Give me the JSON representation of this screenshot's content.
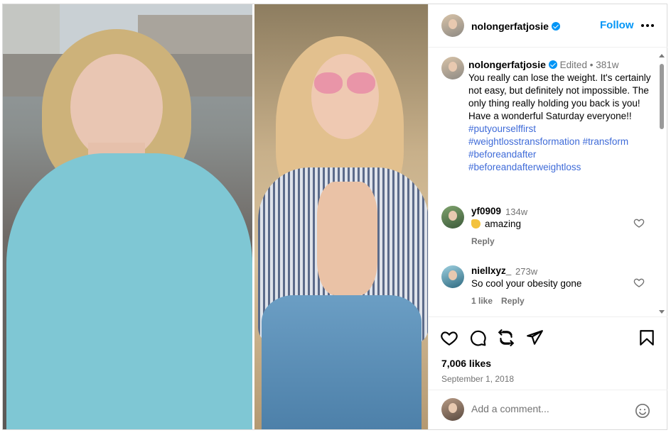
{
  "post": {
    "username": "nolongerfatjosie",
    "follow_label": "Follow",
    "more_icon": "more-horizontal-icon"
  },
  "caption": {
    "username": "nolongerfatjosie",
    "edited": "Edited",
    "separator": "•",
    "time": "381w",
    "text": "You really can lose the weight. It's certainly not easy, but definitely not impossible. The only thing really holding you back is you! Have a wonderful Saturday everyone!!",
    "hashtags": [
      "#putyourselffirst",
      "#weightlosstransformation",
      "#transform",
      "#beforeandafter",
      "#beforeandafterweightloss"
    ]
  },
  "comments": [
    {
      "username": "yf0909",
      "time": "134w",
      "text": "amazing",
      "emoji": "clapping-hands-emoji",
      "likes": "",
      "reply_label": "Reply"
    },
    {
      "username": "niellxyz_",
      "time": "273w",
      "text": "So cool your obesity gone",
      "likes": "1 like",
      "reply_label": "Reply"
    }
  ],
  "actions": {
    "icons": [
      "heart-icon",
      "comment-icon",
      "repost-icon",
      "share-icon",
      "bookmark-icon"
    ]
  },
  "stats": {
    "likes": "7,006 likes",
    "date": "September 1, 2018"
  },
  "add_comment": {
    "placeholder": "Add a comment...",
    "emoji_icon": "smiley-icon"
  },
  "colors": {
    "accent": "#0095f6",
    "hashtag": "#3f6bd8",
    "muted": "#737373",
    "border": "#dbdbdb"
  }
}
